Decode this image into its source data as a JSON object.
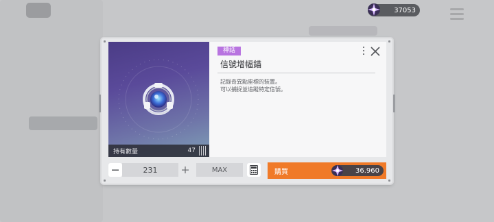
{
  "currency": {
    "icon": "star-gem-icon",
    "amount": "37053"
  },
  "item": {
    "rarity": "神話",
    "name": "信號增幅錨",
    "description_line1": "記錄奇異點座標的裝置。",
    "description_line2": "可以捕捉並追蹤特定信號。",
    "owned_label": "持有數量",
    "owned_count": "47",
    "icon": "signal-amplifier-anchor-icon"
  },
  "quantity": {
    "value": "231",
    "max_label": "MAX"
  },
  "buy": {
    "label": "購買",
    "price": "36.960",
    "currency_icon": "star-gem-icon"
  },
  "colors": {
    "accent_orange": "#f07a28",
    "rarity_purple": "#b874e0"
  }
}
